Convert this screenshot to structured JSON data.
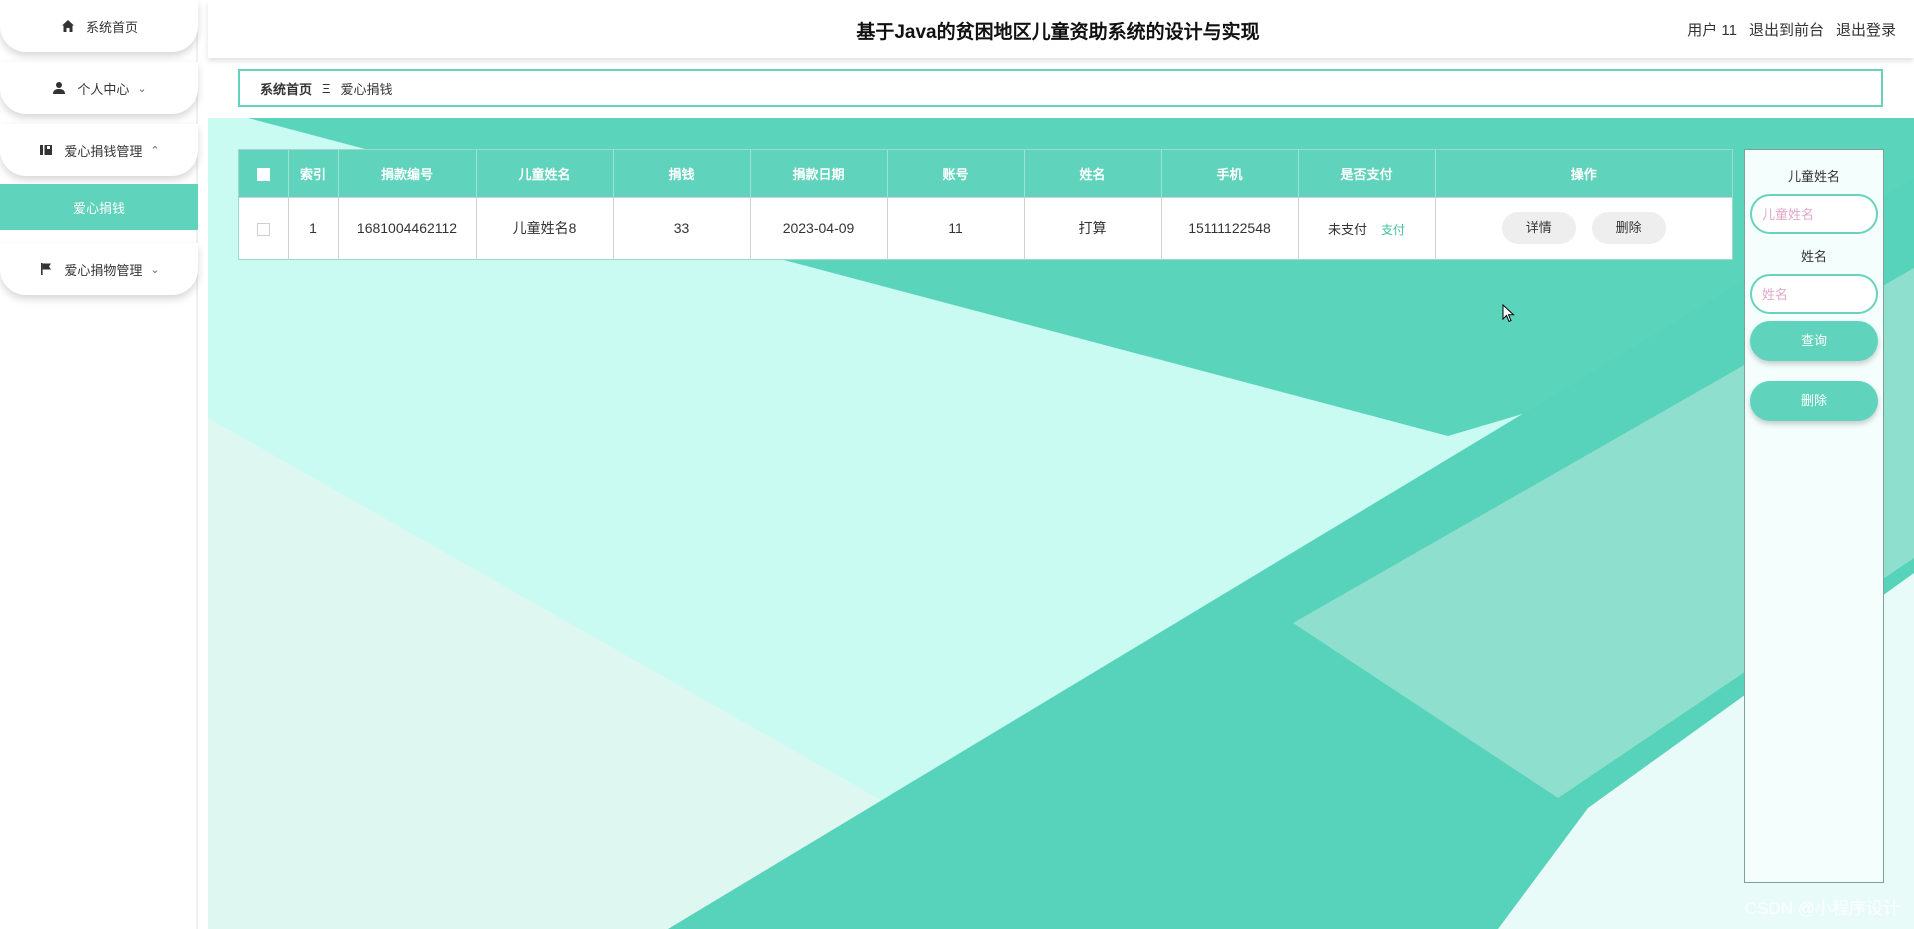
{
  "header": {
    "title": "基于Java的贫困地区儿童资助系统的设计与实现",
    "user": "用户 11",
    "to_front": "退出到前台",
    "logout": "退出登录"
  },
  "sidebar": {
    "items": [
      {
        "label": "系统首页",
        "icon": "home-icon"
      },
      {
        "label": "个人中心",
        "icon": "user-icon"
      },
      {
        "label": "爱心捐钱管理",
        "icon": "book-icon"
      },
      {
        "label": "爱心捐物管理",
        "icon": "flag-icon"
      }
    ],
    "active_sub": "爱心捐钱"
  },
  "breadcrumb": {
    "home": "系统首页",
    "sep": "Ξ",
    "current": "爱心捐钱"
  },
  "table": {
    "columns": [
      "",
      "索引",
      "捐款编号",
      "儿童姓名",
      "捐钱",
      "捐款日期",
      "账号",
      "姓名",
      "手机",
      "是否支付",
      "操作"
    ],
    "rows": [
      {
        "index": "1",
        "donation_no": "1681004462112",
        "child_name": "儿童姓名8",
        "amount": "33",
        "date": "2023-04-09",
        "account": "11",
        "name": "打算",
        "phone": "15111122548",
        "paid": "未支付",
        "pay_link": "支付",
        "detail": "详情",
        "delete": "删除"
      }
    ]
  },
  "search": {
    "child_label": "儿童姓名",
    "child_placeholder": "儿童姓名",
    "name_label": "姓名",
    "name_placeholder": "姓名",
    "query_btn": "查询",
    "delete_btn": "删除"
  },
  "watermark": "CSDN @小程序设计",
  "colors": {
    "accent": "#5fd3bb",
    "border": "#67d3bd"
  }
}
